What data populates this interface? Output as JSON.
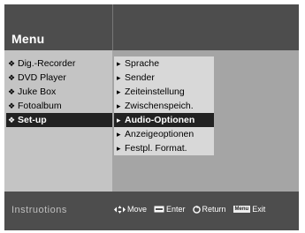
{
  "menu_title": "Menu",
  "left_menu": [
    {
      "label": "Dig.-Recorder",
      "selected": false
    },
    {
      "label": "DVD Player",
      "selected": false
    },
    {
      "label": "Juke Box",
      "selected": false
    },
    {
      "label": "Fotoalbum",
      "selected": false
    },
    {
      "label": "Set-up",
      "selected": true
    }
  ],
  "submenu": [
    {
      "label": "Sprache",
      "selected": false
    },
    {
      "label": "Sender",
      "selected": false
    },
    {
      "label": "Zeiteinstellung",
      "selected": false
    },
    {
      "label": "Zwischenspeich.",
      "selected": false
    },
    {
      "label": "Audio-Optionen",
      "selected": true
    },
    {
      "label": "Anzeigeoptionen",
      "selected": false
    },
    {
      "label": "Festpl. Format.",
      "selected": false
    }
  ],
  "footer": {
    "instructions_label": "Instruotions",
    "hints": {
      "move": "Move",
      "enter": "Enter",
      "return": "Return",
      "menu_key": "Menu",
      "exit": "Exit"
    }
  },
  "icons": {
    "bullet": "diamond-bullet-icon",
    "arrow": "chevron-right-icon",
    "move": "four-way-arrow-icon",
    "enter": "enter-key-icon",
    "return": "return-icon"
  },
  "colors": {
    "header": "#4d4d4d",
    "background": "#a5a5a5",
    "left_panel": "#c4c4c4",
    "selected": "#222222"
  }
}
